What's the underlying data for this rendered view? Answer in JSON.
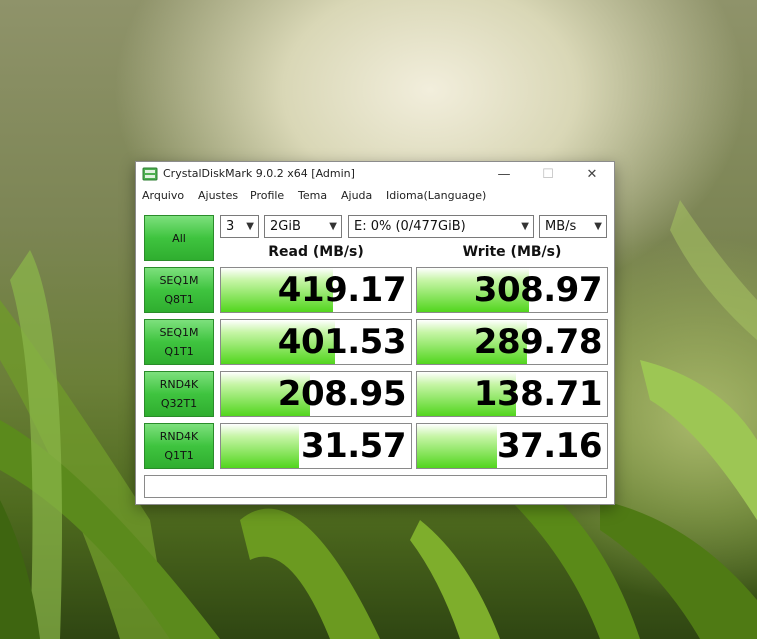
{
  "window": {
    "title": "CrystalDiskMark 9.0.2 x64 [Admin]",
    "controls": {
      "minimize": "—",
      "maximize": "☐",
      "close": "✕"
    }
  },
  "menu": [
    "Arquivo",
    "Ajustes",
    "Profile",
    "Tema",
    "Ajuda",
    "Idioma(Language)"
  ],
  "toolbar": {
    "all_label": "All",
    "count": "3",
    "size": "2GiB",
    "drive": "E: 0% (0/477GiB)",
    "unit": "MB/s"
  },
  "headers": {
    "read": "Read (MB/s)",
    "write": "Write (MB/s)"
  },
  "tests": [
    {
      "line1": "SEQ1M",
      "line2": "Q8T1",
      "read": "419.17",
      "write": "308.97",
      "read_fill": 0.59,
      "write_fill": 0.59
    },
    {
      "line1": "SEQ1M",
      "line2": "Q1T1",
      "read": "401.53",
      "write": "289.78",
      "read_fill": 0.6,
      "write_fill": 0.58
    },
    {
      "line1": "RND4K",
      "line2": "Q32T1",
      "read": "208.95",
      "write": "138.71",
      "read_fill": 0.47,
      "write_fill": 0.52
    },
    {
      "line1": "RND4K",
      "line2": "Q1T1",
      "read": "31.57",
      "write": "37.16",
      "read_fill": 0.41,
      "write_fill": 0.42
    }
  ],
  "status": "",
  "colors": {
    "accent_green": "#3fc43f",
    "bar_green": "#52d61e"
  }
}
